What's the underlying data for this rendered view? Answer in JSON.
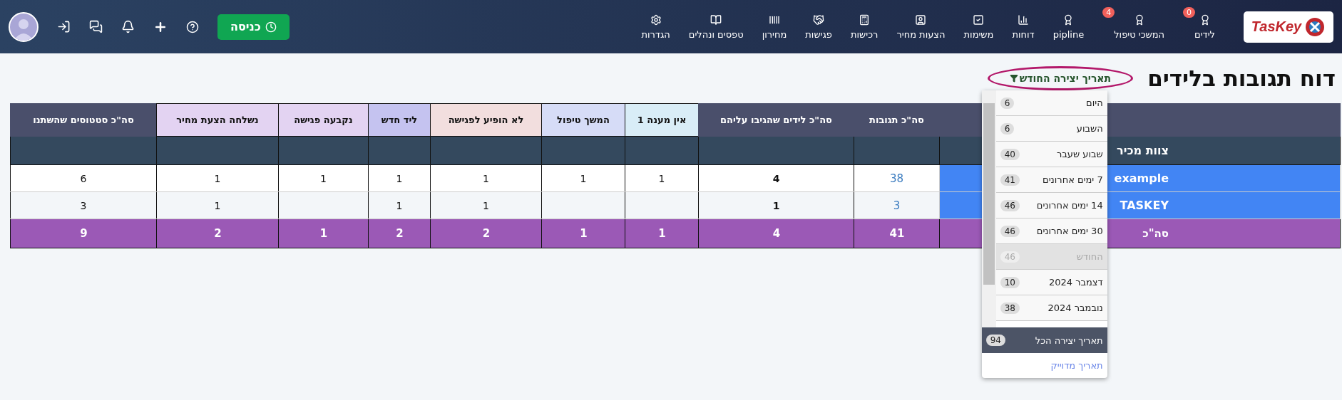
{
  "nav": {
    "logo": "TasKey",
    "items": [
      {
        "label": "לידים",
        "badge": "0"
      },
      {
        "label": "המשכי טיפול",
        "badge": "4"
      },
      {
        "label": "pipline"
      },
      {
        "label": "דוחות"
      },
      {
        "label": "משימות"
      },
      {
        "label": "הצעות מחיר"
      },
      {
        "label": "רכישות"
      },
      {
        "label": "פגישות"
      },
      {
        "label": "מחירון"
      },
      {
        "label": "טפסים ונהלים"
      },
      {
        "label": "הגדרות"
      }
    ],
    "enter_button": "כניסה"
  },
  "title": "דוח תגובות בלידים",
  "filter": {
    "label": "תאריך יצירה החודש",
    "options": [
      {
        "label": "היום",
        "count": "6",
        "selected": false
      },
      {
        "label": "השבוע",
        "count": "6",
        "selected": false
      },
      {
        "label": "שבוע שעבר",
        "count": "40",
        "selected": false
      },
      {
        "label": "7 ימים אחרונים",
        "count": "41",
        "selected": false
      },
      {
        "label": "14 ימים אחרונים",
        "count": "46",
        "selected": false
      },
      {
        "label": "30 ימים אחרונים",
        "count": "46",
        "selected": false
      },
      {
        "label": "החודש",
        "count": "46",
        "selected": true
      },
      {
        "label": "דצמבר 2024",
        "count": "10",
        "selected": false
      },
      {
        "label": "נובמבר 2024",
        "count": "38",
        "selected": false
      }
    ],
    "all_option": {
      "label": "תאריך יצירה הכל",
      "count": "94"
    },
    "exact_link": "תאריך מדוייק"
  },
  "table": {
    "columns": [
      {
        "color": "#4a4f6b"
      },
      {
        "label": "סה\"כ תגובות",
        "color": "#4a4f6b"
      },
      {
        "label": "סה\"כ לידים שהגיבו עליהם",
        "color": "#4a4f6b"
      },
      {
        "label": "אין מענה 1",
        "color": "#d9edf7"
      },
      {
        "label": "המשך טיפול",
        "color": "#d6dcf7"
      },
      {
        "label": "לא הופיע לפגישה",
        "color": "#f2dede"
      },
      {
        "label": "ליד חדש",
        "color": "#c5c3f0"
      },
      {
        "label": "נקבעה פגישה",
        "color": "#e3d3f2"
      },
      {
        "label": "נשלחה הצעת מחיר",
        "color": "#e3d3f2"
      },
      {
        "label": "סה\"כ סטטוסים שהשתנו",
        "color": "#4a4f6b"
      }
    ],
    "group_label": "צוות מכיר",
    "rows": [
      {
        "cells": [
          "example",
          "38",
          "4",
          "1",
          "1",
          "1",
          "1",
          "1",
          "1",
          "6"
        ]
      },
      {
        "cells": [
          "TASKEY",
          "3",
          "1",
          null,
          null,
          "1",
          "1",
          null,
          "1",
          "3"
        ]
      }
    ],
    "total": {
      "cells": [
        "סה\"כ",
        "41",
        "4",
        "1",
        "1",
        "2",
        "2",
        "1",
        "2",
        "9"
      ]
    }
  }
}
